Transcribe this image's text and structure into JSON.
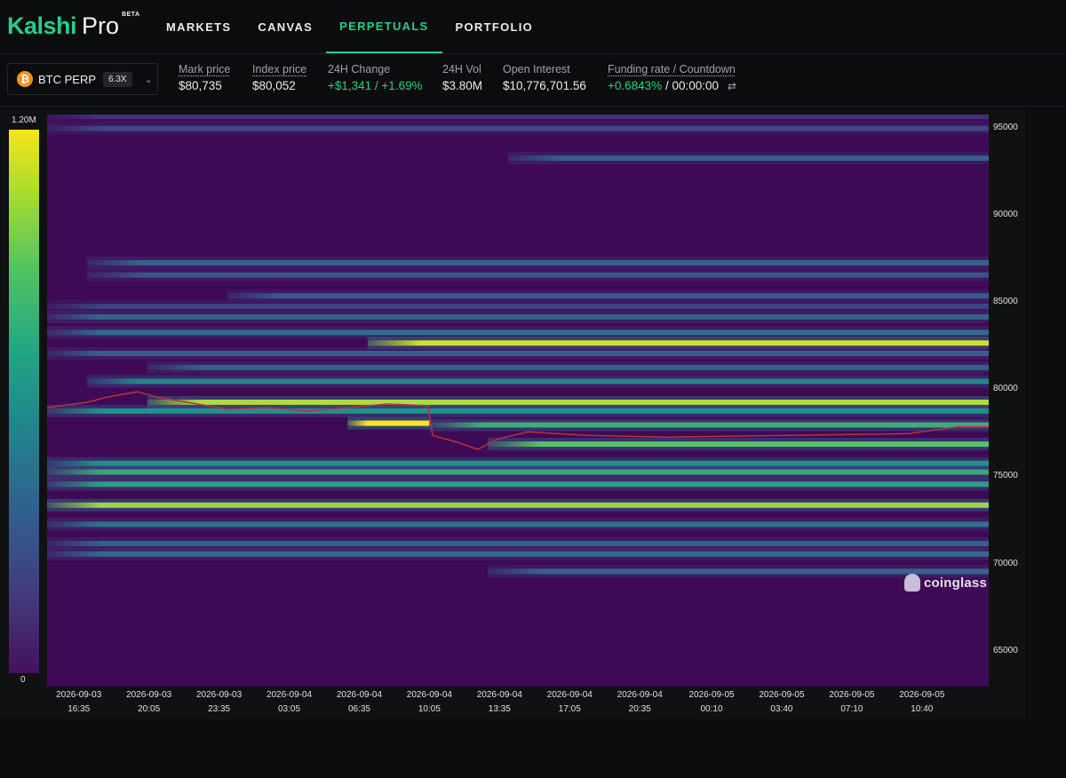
{
  "brand": {
    "name": "Kalshi",
    "product": "Pro",
    "badge": "BETA"
  },
  "nav": [
    "MARKETS",
    "CANVAS",
    "PERPETUALS",
    "PORTFOLIO"
  ],
  "active_nav": "PERPETUALS",
  "market": {
    "symbol": "BTC PERP",
    "leverage": "6.3X",
    "icon": "bitcoin-icon",
    "coin_symbol": "₿"
  },
  "stats": {
    "mark_price": {
      "label": "Mark price",
      "value": "$80,735"
    },
    "index_price": {
      "label": "Index price",
      "value": "$80,052"
    },
    "change_24h": {
      "label": "24H Change",
      "value": "+$1,341 / +1.69%"
    },
    "vol_24h": {
      "label": "24H Vol",
      "value": "$3.80M"
    },
    "open_interest": {
      "label": "Open Interest",
      "value": "$10,776,701.56"
    },
    "funding": {
      "label": "Funding rate / Countdown",
      "rate": "+0.6843%",
      "separator": "/",
      "countdown": "00:00:00"
    }
  },
  "colors": {
    "accent": "#28cc8b",
    "background": "#0b0c0e",
    "heatmap_base": "#3f0a55",
    "price_line": "#b3343f"
  },
  "watermark": "coinglass",
  "chart_data": {
    "type": "heatmap",
    "colorbar": {
      "min_label": "0",
      "max_label": "1.20M",
      "min": 0,
      "max": 1200000
    },
    "y_ticks": [
      95000,
      90000,
      85000,
      80000,
      75000,
      70000,
      65000
    ],
    "ylim": [
      63000,
      95800
    ],
    "x_ticks": [
      {
        "date": "2026-09-03",
        "time": "16:35"
      },
      {
        "date": "2026-09-03",
        "time": "20:05"
      },
      {
        "date": "2026-09-03",
        "time": "23:35"
      },
      {
        "date": "2026-09-04",
        "time": "03:05"
      },
      {
        "date": "2026-09-04",
        "time": "06:35"
      },
      {
        "date": "2026-09-04",
        "time": "10:05"
      },
      {
        "date": "2026-09-04",
        "time": "13:35"
      },
      {
        "date": "2026-09-04",
        "time": "17:05"
      },
      {
        "date": "2026-09-04",
        "time": "20:35"
      },
      {
        "date": "2026-09-05",
        "time": "00:10"
      },
      {
        "date": "2026-09-05",
        "time": "03:40"
      },
      {
        "date": "2026-09-05",
        "time": "07:10"
      },
      {
        "date": "2026-09-05",
        "time": "10:40"
      }
    ],
    "xlim": [
      "2026-09-03 15:00",
      "2026-09-05 14:00"
    ],
    "liquidation_bands": [
      {
        "price": 95700,
        "start": "2026-09-03 15:00",
        "intensity": 0.15
      },
      {
        "price": 95000,
        "start": "2026-09-03 15:00",
        "intensity": 0.22
      },
      {
        "price": 93300,
        "start": "2026-09-04 14:00",
        "intensity": 0.3
      },
      {
        "price": 87300,
        "start": "2026-09-03 17:00",
        "intensity": 0.32
      },
      {
        "price": 86600,
        "start": "2026-09-03 17:00",
        "intensity": 0.25
      },
      {
        "price": 85400,
        "start": "2026-09-04 00:00",
        "intensity": 0.28
      },
      {
        "price": 84800,
        "start": "2026-09-03 15:00",
        "intensity": 0.2
      },
      {
        "price": 84200,
        "start": "2026-09-03 15:00",
        "intensity": 0.32
      },
      {
        "price": 83300,
        "start": "2026-09-03 15:00",
        "intensity": 0.35
      },
      {
        "price": 82700,
        "start": "2026-09-04 07:00",
        "intensity": 0.93
      },
      {
        "price": 82100,
        "start": "2026-09-03 15:00",
        "intensity": 0.3
      },
      {
        "price": 81300,
        "start": "2026-09-03 20:00",
        "intensity": 0.3
      },
      {
        "price": 80500,
        "start": "2026-09-03 17:00",
        "intensity": 0.45
      },
      {
        "price": 79300,
        "start": "2026-09-03 20:00",
        "intensity": 0.88
      },
      {
        "price": 78800,
        "start": "2026-09-03 15:00",
        "intensity": 0.5
      },
      {
        "price": 78100,
        "start": "2026-09-04 06:00",
        "end": "2026-09-04 10:05",
        "intensity": 1.0
      },
      {
        "price": 78000,
        "start": "2026-09-04 10:05",
        "intensity": 0.62
      },
      {
        "price": 76900,
        "start": "2026-09-04 13:00",
        "intensity": 0.72
      },
      {
        "price": 75800,
        "start": "2026-09-03 15:00",
        "intensity": 0.5
      },
      {
        "price": 75300,
        "start": "2026-09-03 15:00",
        "intensity": 0.6
      },
      {
        "price": 74600,
        "start": "2026-09-03 15:00",
        "intensity": 0.55
      },
      {
        "price": 73400,
        "start": "2026-09-03 15:00",
        "intensity": 0.85
      },
      {
        "price": 72300,
        "start": "2026-09-03 15:00",
        "intensity": 0.38
      },
      {
        "price": 71200,
        "start": "2026-09-03 15:00",
        "intensity": 0.3
      },
      {
        "price": 70600,
        "start": "2026-09-03 15:00",
        "intensity": 0.35
      },
      {
        "price": 69600,
        "start": "2026-09-04 13:00",
        "intensity": 0.32
      }
    ],
    "price_series": [
      {
        "t": "2026-09-03 15:00",
        "price": 79000
      },
      {
        "t": "2026-09-03 17:00",
        "price": 79300
      },
      {
        "t": "2026-09-03 18:00",
        "price": 79600
      },
      {
        "t": "2026-09-03 19:30",
        "price": 79900
      },
      {
        "t": "2026-09-03 20:30",
        "price": 79600
      },
      {
        "t": "2026-09-03 22:00",
        "price": 79300
      },
      {
        "t": "2026-09-04 00:00",
        "price": 78900
      },
      {
        "t": "2026-09-04 02:00",
        "price": 79000
      },
      {
        "t": "2026-09-04 04:00",
        "price": 78800
      },
      {
        "t": "2026-09-04 06:00",
        "price": 79000
      },
      {
        "t": "2026-09-04 08:00",
        "price": 79200
      },
      {
        "t": "2026-09-04 10:00",
        "price": 79100
      },
      {
        "t": "2026-09-04 10:15",
        "price": 77400
      },
      {
        "t": "2026-09-04 11:30",
        "price": 77000
      },
      {
        "t": "2026-09-04 12:30",
        "price": 76600
      },
      {
        "t": "2026-09-04 13:30",
        "price": 77200
      },
      {
        "t": "2026-09-04 15:00",
        "price": 77600
      },
      {
        "t": "2026-09-04 18:00",
        "price": 77400
      },
      {
        "t": "2026-09-04 22:00",
        "price": 77300
      },
      {
        "t": "2026-09-05 04:00",
        "price": 77400
      },
      {
        "t": "2026-09-05 10:00",
        "price": 77500
      },
      {
        "t": "2026-09-05 12:30",
        "price": 77900
      },
      {
        "t": "2026-09-05 14:00",
        "price": 77900
      }
    ]
  }
}
